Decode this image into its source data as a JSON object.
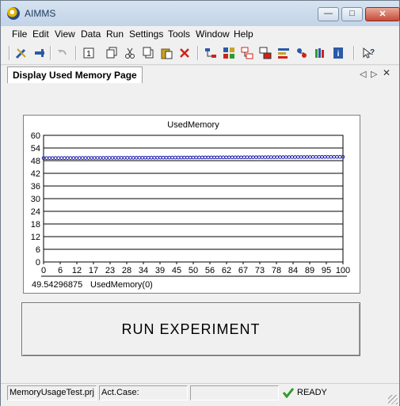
{
  "window": {
    "title": "AIMMS"
  },
  "menu": [
    {
      "label": "File"
    },
    {
      "label": "Edit"
    },
    {
      "label": "View"
    },
    {
      "label": "Data"
    },
    {
      "label": "Run"
    },
    {
      "label": "Settings"
    },
    {
      "label": "Tools"
    },
    {
      "label": "Window"
    },
    {
      "label": "Help"
    }
  ],
  "tab": {
    "label": "Display Used Memory Page"
  },
  "chart_data": {
    "type": "scatter",
    "title": "UsedMemory",
    "xlabel": "",
    "ylabel": "",
    "xlim": [
      0,
      100
    ],
    "ylim": [
      0,
      60
    ],
    "x_tick_labels": [
      "0",
      "6",
      "12",
      "17",
      "23",
      "28",
      "34",
      "39",
      "45",
      "50",
      "56",
      "62",
      "67",
      "73",
      "78",
      "84",
      "89",
      "95",
      "100"
    ],
    "y_tick_labels": [
      "0",
      "6",
      "12",
      "18",
      "24",
      "30",
      "36",
      "42",
      "48",
      "54",
      "60"
    ],
    "grid": "horizontal",
    "series": [
      {
        "start_value": 49.2,
        "end_value": 49.8,
        "color": "#1a1aaa"
      }
    ],
    "readout_value": "49.54296875",
    "readout_label": "UsedMemory(0)"
  },
  "run_button": {
    "label": "RUN   EXPERIMENT"
  },
  "status": {
    "project": "MemoryUsageTest.prj",
    "case": "Act.Case:",
    "state": "READY"
  },
  "colors": {
    "accent": "#1e395b",
    "series": "#1a1aaa",
    "ready_check": "#2e9b2e"
  }
}
